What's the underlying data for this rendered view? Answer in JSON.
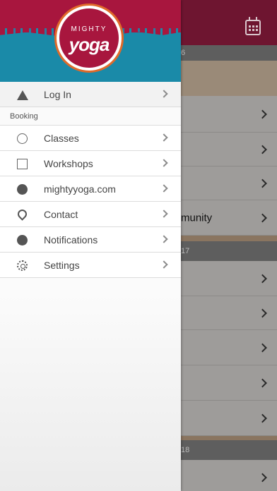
{
  "app": {
    "logo_top": "MIGHTY",
    "logo_bottom": "yoga"
  },
  "menu": {
    "login": {
      "label": "Log In",
      "icon": "warning-icon"
    },
    "booking_header": "Booking",
    "items": [
      {
        "label": "Classes",
        "icon": "circle-icon"
      },
      {
        "label": "Workshops",
        "icon": "square-icon"
      },
      {
        "label": "mightyyoga.com",
        "icon": "globe-icon"
      },
      {
        "label": "Contact",
        "icon": "map-pin-icon"
      },
      {
        "label": "Notifications",
        "icon": "chat-bubble-icon"
      },
      {
        "label": "Settings",
        "icon": "gear-icon"
      }
    ]
  },
  "background": {
    "section_1": "6",
    "section_2": "17",
    "section_3": "18",
    "row_text": "munity"
  },
  "colors": {
    "brand_red": "#a8163e",
    "brand_teal": "#1a8aa8",
    "brand_orange": "#e06a2a"
  }
}
